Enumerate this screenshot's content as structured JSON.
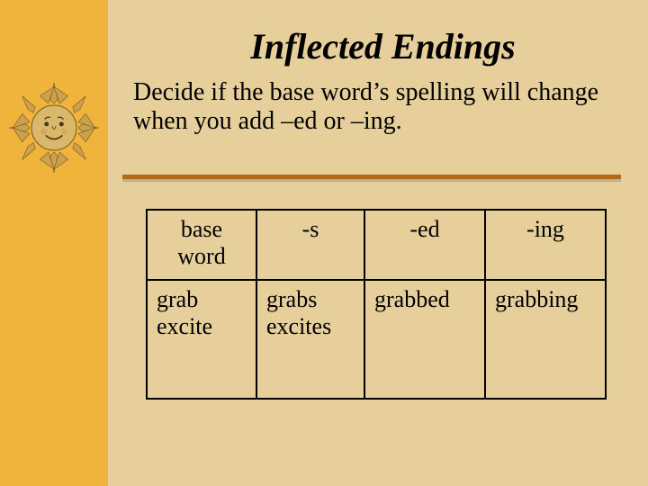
{
  "title": "Inflected Endings",
  "body": "Decide if the base word’s spelling will change when you add –ed or –ing.",
  "table": {
    "headers": {
      "base": "base word",
      "s": "-s",
      "ed": "-ed",
      "ing": "-ing"
    },
    "cells": {
      "base": "grab\nexcite",
      "s": "grabs\nexcites",
      "ed": "grabbed",
      "ing": "grabbing"
    }
  },
  "chart_data": {
    "type": "table",
    "title": "Inflected Endings",
    "columns": [
      "base word",
      "-s",
      "-ed",
      "-ing"
    ],
    "rows": [
      {
        "base word": "grab",
        "-s": "grabs",
        "-ed": "grabbed",
        "-ing": "grabbing"
      },
      {
        "base word": "excite",
        "-s": "excites",
        "-ed": "",
        "-ing": ""
      }
    ]
  },
  "decorative": {
    "sun_icon": "sun-face-icon"
  }
}
